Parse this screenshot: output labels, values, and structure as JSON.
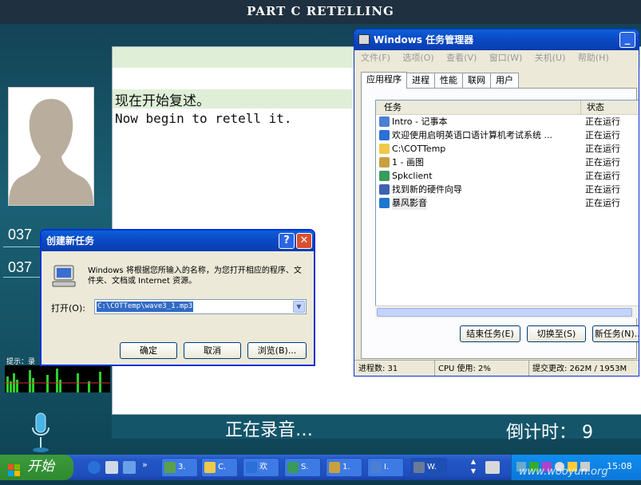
{
  "exam": {
    "header": "PART C   RETELLING",
    "zh_prompt": "现在开始复述。",
    "en_prompt": "Now begin to retell it.",
    "id_prefix_1": "037",
    "id_prefix_2": "037",
    "tip_label": "提示：录",
    "recording": "正在录音…",
    "countdown_label": "倒计时：",
    "countdown_value": "9"
  },
  "task_manager": {
    "title": "Windows 任务管理器",
    "menu": [
      "文件(F)",
      "选项(O)",
      "查看(V)",
      "窗口(W)",
      "关机(U)",
      "帮助(H)"
    ],
    "tabs": [
      "应用程序",
      "进程",
      "性能",
      "联网",
      "用户"
    ],
    "active_tab": "应用程序",
    "columns": {
      "task": "任务",
      "status": "状态"
    },
    "rows": [
      {
        "name": "Intro - 记事本",
        "status": "正在运行",
        "icon": "notepad-icon",
        "color": "#4a7fd4"
      },
      {
        "name": "欢迎使用启明英语口语计算机考试系统 ...",
        "status": "正在运行",
        "icon": "ie-icon",
        "color": "#2b6fd8"
      },
      {
        "name": "C:\\COTTemp",
        "status": "正在运行",
        "icon": "folder-icon",
        "color": "#f0c94a"
      },
      {
        "name": "1 - 画图",
        "status": "正在运行",
        "icon": "paint-icon",
        "color": "#c8a040"
      },
      {
        "name": "Spkclient",
        "status": "正在运行",
        "icon": "app-icon",
        "color": "#3a9a5a"
      },
      {
        "name": "找到新的硬件向导",
        "status": "正在运行",
        "icon": "window-icon",
        "color": "#4060b0"
      },
      {
        "name": "暴风影音",
        "status": "正在运行",
        "icon": "player-icon",
        "color": "#1f76d0"
      }
    ],
    "buttons": {
      "end": "结束任务(E)",
      "switch": "切换至(S)",
      "new": "新任务(N)..."
    },
    "status": {
      "processes": "进程数: 31",
      "cpu": "CPU 使用: 2%",
      "commit": "提交更改: 262M / 1953M"
    }
  },
  "dialog": {
    "title": "创建新任务",
    "help": "?",
    "close": "✕",
    "message": "Windows 将根据您所输入的名称，为您打开相应的程序、文件夹、文档或 Internet 资源。",
    "open_label": "打开(O):",
    "open_value": "C:\\COTTemp\\wave3_1.mp3",
    "ok": "确定",
    "cancel": "取消",
    "browse": "浏览(B)..."
  },
  "taskbar": {
    "start": "开始",
    "items": [
      {
        "label": "3.",
        "color": "#5aa04a"
      },
      {
        "label": "C.",
        "color": "#f0c94a"
      },
      {
        "label": "欢",
        "color": "#2b6fd8"
      },
      {
        "label": "S.",
        "color": "#3a9a5a"
      },
      {
        "label": "1.",
        "color": "#c8a040"
      },
      {
        "label": "I.",
        "color": "#4a7fd4"
      },
      {
        "label": "W.",
        "color": "#6a7a9a"
      }
    ],
    "clock": "15:08",
    "watermark": "www.wooyun.org"
  }
}
